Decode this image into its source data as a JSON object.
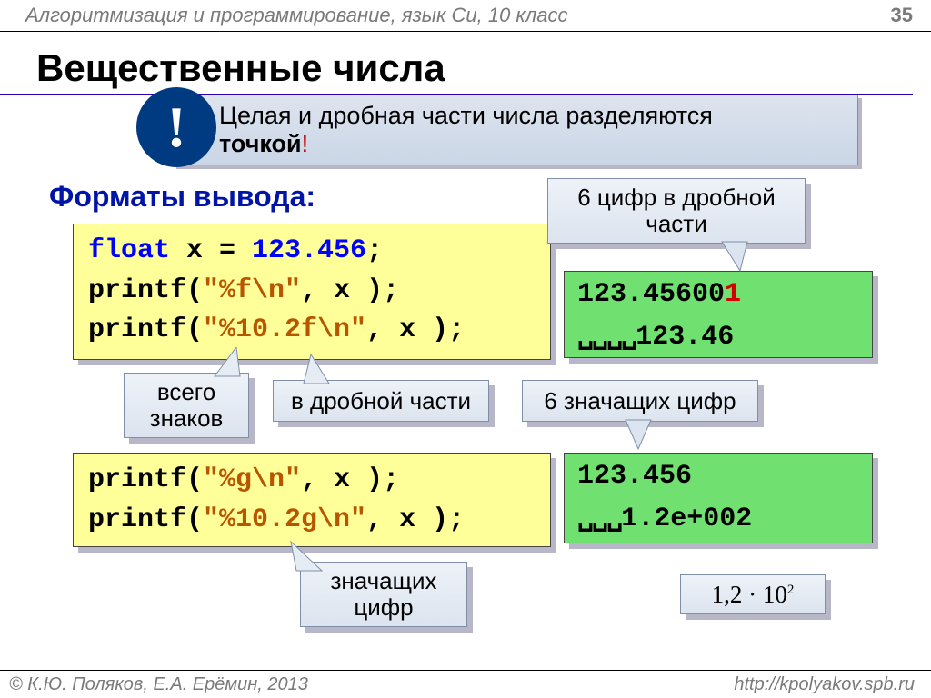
{
  "header": {
    "breadcrumb": "Алгоритмизация и программирование, язык Си, 10 класс",
    "page": "35"
  },
  "title": "Вещественные числа",
  "exclam": {
    "mark": "!",
    "line1": "Целая и дробная части числа разделяются ",
    "bold": "точкой",
    "excl": "!"
  },
  "subhead": "Форматы вывода:",
  "code1": {
    "l1a": "float",
    "l1b": " x = ",
    "l1c": "123.456",
    "l1d": ";",
    "l2a": "printf(",
    "l2b": "\"%f\\n\"",
    "l2c": ", x );",
    "l3a": "printf(",
    "l3b": "\"%10.2f\\n\"",
    "l3c": ", x );"
  },
  "out1": {
    "l1a": "123.45600",
    "l1b": "1",
    "l2_spaces": "␣␣␣␣",
    "l2b": "123.46"
  },
  "code2": {
    "l1a": "printf(",
    "l1b": "\"%g\\n\"",
    "l1c": ", x );",
    "l2a": "printf(",
    "l2b": "\"%10.2g\\n\"",
    "l2c": ", x );"
  },
  "out2": {
    "l1": "123.456",
    "l2_spaces": "␣␣␣",
    "l2b": "1.2e+002"
  },
  "callouts": {
    "c6frac": "6 цифр в дробной части",
    "total": "всего знаков",
    "frac": "в дробной части",
    "sig6": "6 значащих цифр",
    "sig": "значащих цифр"
  },
  "mathnote": "1,2 · 10²",
  "footer": {
    "left": "© К.Ю. Поляков, Е.А. Ерёмин, 2013",
    "right": "http://kpolyakov.spb.ru"
  }
}
